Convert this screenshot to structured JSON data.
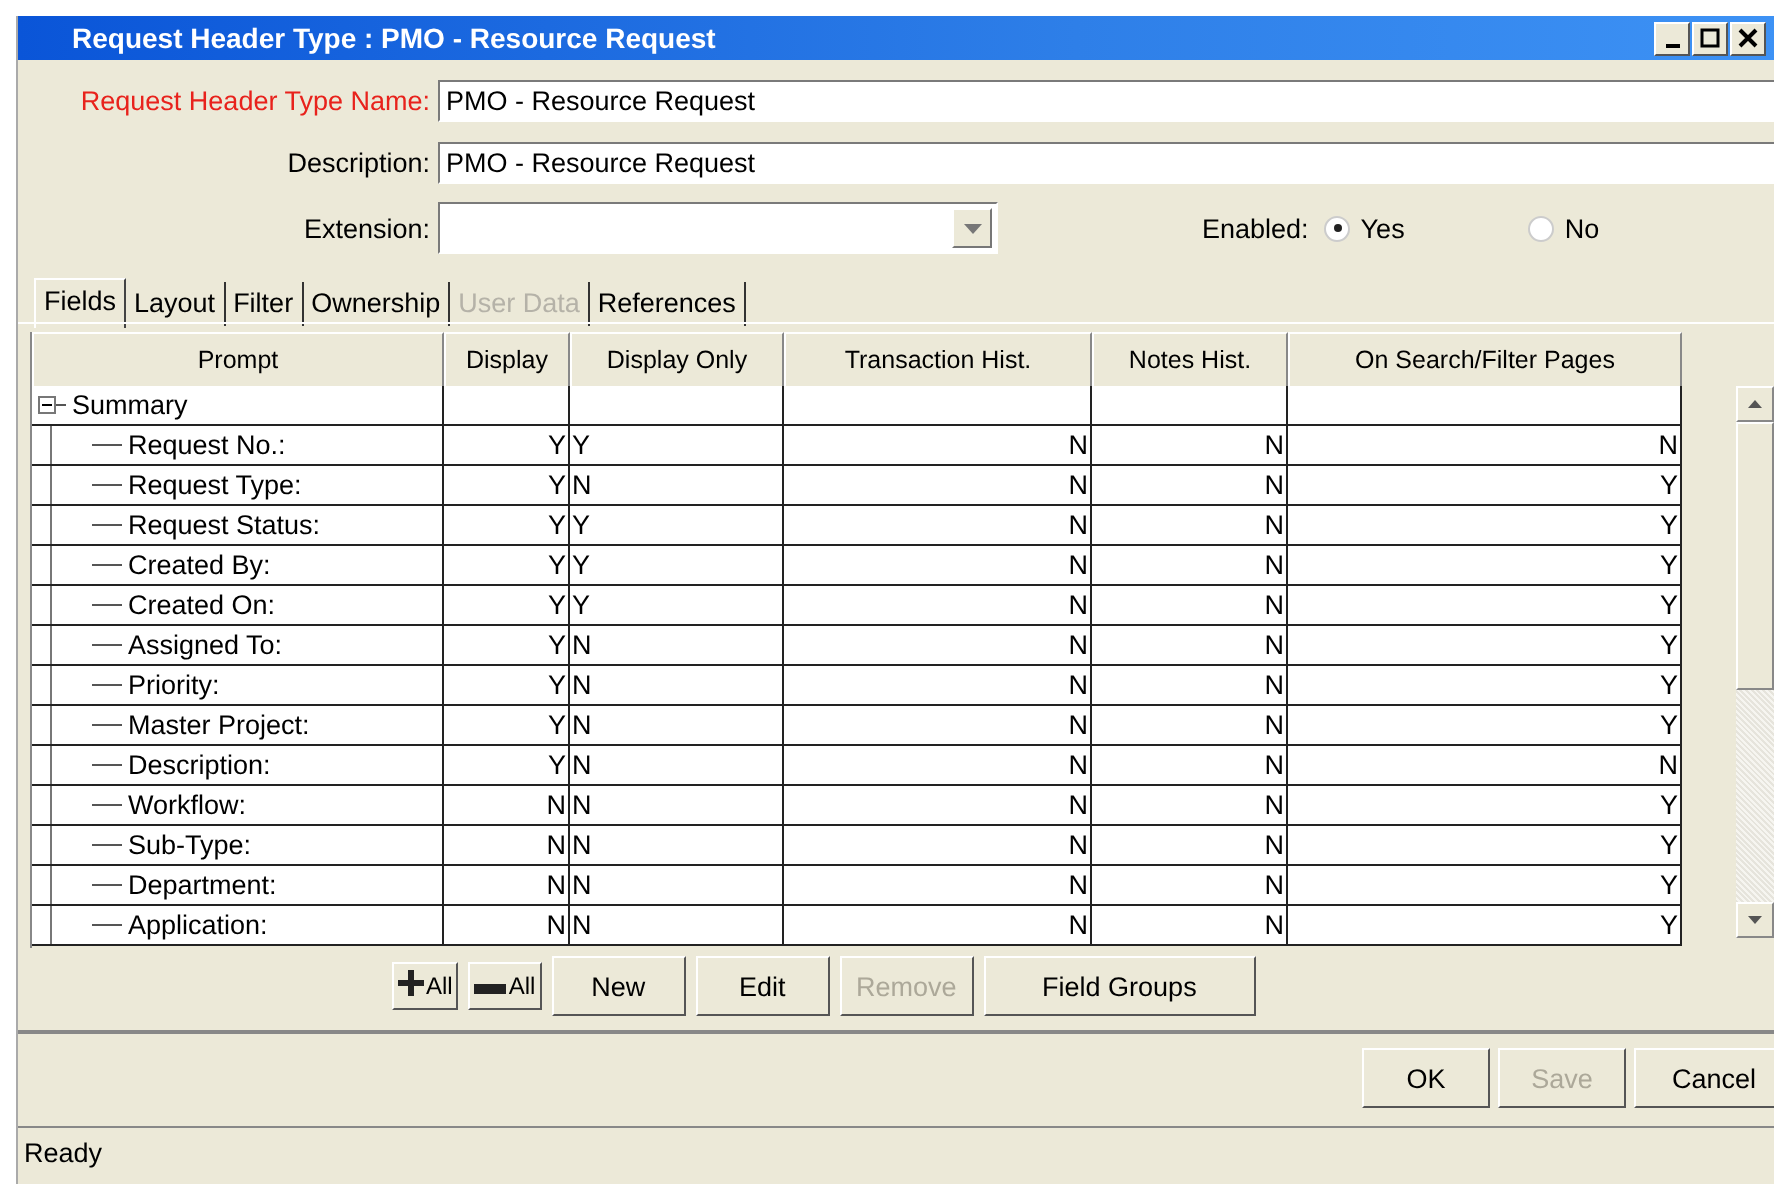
{
  "window": {
    "title": "Request Header Type : PMO - Resource Request"
  },
  "form": {
    "fields": [
      {
        "label": "Request Header Type Name:",
        "required": true,
        "kind": "text",
        "value": "PMO - Resource Request"
      },
      {
        "label": "Description:",
        "required": false,
        "kind": "text",
        "value": "PMO - Resource Request"
      },
      {
        "label": "Extension:",
        "required": false,
        "kind": "dropdown"
      }
    ],
    "enabled": {
      "label": "Enabled:",
      "options": [
        {
          "label": "Yes",
          "selected": true
        },
        {
          "label": "No",
          "selected": false
        }
      ]
    }
  },
  "tabs": [
    {
      "label": "Fields",
      "selected": true,
      "disabled": false
    },
    {
      "label": "Layout",
      "selected": false,
      "disabled": false
    },
    {
      "label": "Filter",
      "selected": false,
      "disabled": false
    },
    {
      "label": "Ownership",
      "selected": false,
      "disabled": false
    },
    {
      "label": "User Data",
      "selected": false,
      "disabled": true
    },
    {
      "label": "References",
      "selected": false,
      "disabled": false
    }
  ],
  "table": {
    "columns": [
      "Prompt",
      "Display",
      "Display Only",
      "Transaction Hist.",
      "Notes Hist.",
      "On Search/Filter Pages"
    ],
    "tree": [
      {
        "prompt": "Summary",
        "expanded": true,
        "children": [
          {
            "prompt": "Request No.:",
            "cells": [
              "Y",
              "Y",
              "N",
              "N",
              "N"
            ]
          },
          {
            "prompt": "Request Type:",
            "cells": [
              "Y",
              "N",
              "N",
              "N",
              "Y"
            ]
          },
          {
            "prompt": "Request Status:",
            "cells": [
              "Y",
              "Y",
              "N",
              "N",
              "Y"
            ]
          },
          {
            "prompt": "Created By:",
            "cells": [
              "Y",
              "Y",
              "N",
              "N",
              "Y"
            ]
          },
          {
            "prompt": "Created On:",
            "cells": [
              "Y",
              "Y",
              "N",
              "N",
              "Y"
            ]
          },
          {
            "prompt": "Assigned To:",
            "cells": [
              "Y",
              "N",
              "N",
              "N",
              "Y"
            ]
          },
          {
            "prompt": "Priority:",
            "cells": [
              "Y",
              "N",
              "N",
              "N",
              "Y"
            ]
          },
          {
            "prompt": "Master Project:",
            "cells": [
              "Y",
              "N",
              "N",
              "N",
              "Y"
            ]
          },
          {
            "prompt": "Description:",
            "cells": [
              "Y",
              "N",
              "N",
              "N",
              "N"
            ]
          },
          {
            "prompt": "Workflow:",
            "cells": [
              "N",
              "N",
              "N",
              "N",
              "Y"
            ]
          },
          {
            "prompt": "Sub-Type:",
            "cells": [
              "N",
              "N",
              "N",
              "N",
              "Y"
            ]
          },
          {
            "prompt": "Department:",
            "cells": [
              "N",
              "N",
              "N",
              "N",
              "Y"
            ]
          },
          {
            "prompt": "Application:",
            "cells": [
              "N",
              "N",
              "N",
              "N",
              "Y"
            ]
          }
        ]
      }
    ]
  },
  "table_buttons": [
    {
      "label": "All",
      "kind": "expand",
      "disabled": false
    },
    {
      "label": "All",
      "kind": "collapse",
      "disabled": false
    },
    {
      "label": "New",
      "kind": "text",
      "disabled": false
    },
    {
      "label": "Edit",
      "kind": "text",
      "disabled": false
    },
    {
      "label": "Remove",
      "kind": "text",
      "disabled": true
    },
    {
      "label": "Field Groups",
      "kind": "text",
      "disabled": false
    }
  ],
  "dialog_buttons": [
    {
      "label": "OK",
      "disabled": false
    },
    {
      "label": "Save",
      "disabled": true
    },
    {
      "label": "Cancel",
      "disabled": false
    }
  ],
  "status_bar": {
    "text": "Ready"
  }
}
